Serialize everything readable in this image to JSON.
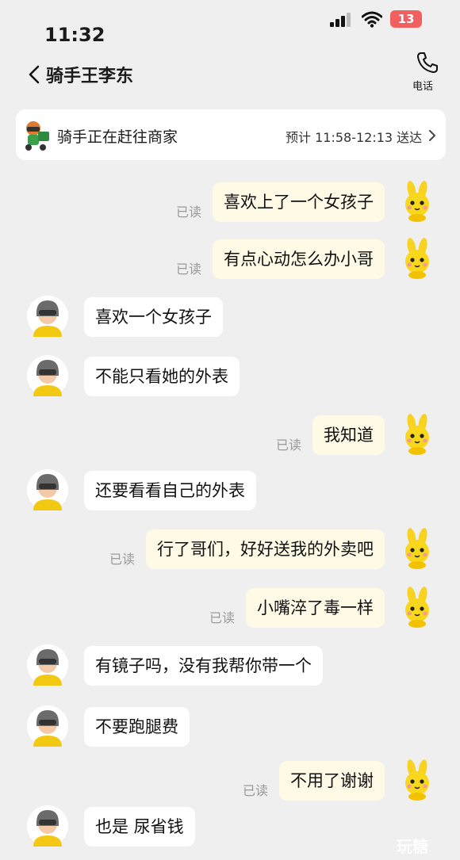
{
  "status_bar": {
    "time": "11:32",
    "battery": "13"
  },
  "header": {
    "title": "骑手王李东",
    "call_label": "电话"
  },
  "delivery": {
    "status": "骑手正在赶往商家",
    "eta": "预计 11:58-12:13 送达"
  },
  "messages": [
    {
      "from": "me",
      "text": "喜欢上了一个女孩子",
      "read": "已读"
    },
    {
      "from": "me",
      "text": "有点心动怎么办小哥",
      "read": "已读"
    },
    {
      "from": "rider",
      "text": "喜欢一个女孩子"
    },
    {
      "from": "rider",
      "text": "不能只看她的外表"
    },
    {
      "from": "me",
      "text": "我知道",
      "read": "已读"
    },
    {
      "from": "rider",
      "text": "还要看看自己的外表"
    },
    {
      "from": "me",
      "text": "行了哥们，好好送我的外卖吧",
      "read": "已读"
    },
    {
      "from": "me",
      "text": "小嘴淬了毒一样",
      "read": "已读"
    },
    {
      "from": "rider",
      "text": "有镜子吗，没有我帮你带一个"
    },
    {
      "from": "rider",
      "text": "不要跑腿费"
    },
    {
      "from": "me",
      "text": "不用了谢谢",
      "read": "已读"
    },
    {
      "from": "rider",
      "text": "也是 尿省钱"
    }
  ],
  "watermark": "玩糖",
  "icons": {
    "me_avatar": "yellow-bunny-icon",
    "rider_avatar": "rider-helmet-icon",
    "back": "chevron-left-icon",
    "call": "phone-icon"
  }
}
